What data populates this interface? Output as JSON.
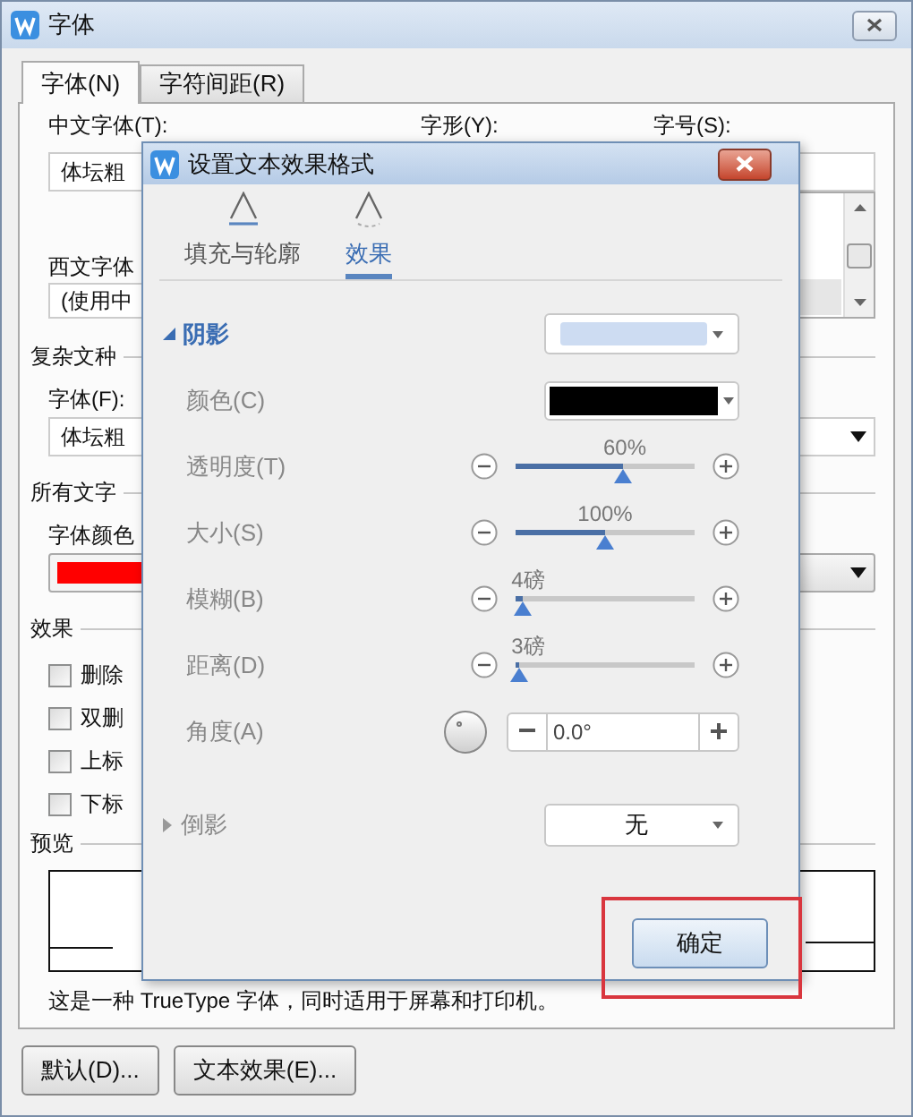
{
  "font_window": {
    "title": "字体",
    "tabs": [
      {
        "label": "字体(N)",
        "selected": true
      },
      {
        "label": "字符间距(R)",
        "selected": false
      }
    ],
    "chinese_font": {
      "label": "中文字体(T):",
      "value": "体坛粗"
    },
    "style_label": "字形(Y):",
    "size_label": "字号(S):",
    "western_font": {
      "label": "西文字体",
      "value": "(使用中"
    },
    "complex_script": {
      "heading": "复杂文种",
      "label": "字体(F):",
      "value": "体坛粗"
    },
    "all_text": {
      "heading": "所有文字",
      "color_label": "字体颜色",
      "color": "#ff0000"
    },
    "effects": {
      "heading": "效果",
      "options": [
        {
          "label": "删除",
          "checked": false
        },
        {
          "label": "双删",
          "checked": false
        },
        {
          "label": "上标",
          "checked": false
        },
        {
          "label": "下标",
          "checked": false
        }
      ]
    },
    "preview": {
      "heading": "预览"
    },
    "note": "这是一种 TrueType 字体，同时适用于屏幕和打印机。",
    "buttons": [
      "默认(D)...",
      "文本效果(E)..."
    ]
  },
  "effects_dialog": {
    "title": "设置文本效果格式",
    "tabs": [
      {
        "label": "填充与轮廓",
        "selected": false
      },
      {
        "label": "效果",
        "selected": true
      }
    ],
    "shadow": {
      "label": "阴影",
      "expanded": true,
      "rows": [
        {
          "kind": "color",
          "label": "颜色(C)",
          "color": "#000000"
        },
        {
          "kind": "slider",
          "label": "透明度(T)",
          "level": 0.6,
          "reading": "60%"
        },
        {
          "kind": "slider",
          "label": "大小(S)",
          "level": 0.5,
          "reading": "100%"
        },
        {
          "kind": "slider",
          "label": "模糊(B)",
          "level": 0.04,
          "reading": "4磅"
        },
        {
          "kind": "slider",
          "label": "距离(D)",
          "level": 0.02,
          "reading": "3磅"
        },
        {
          "kind": "angle",
          "label": "角度(A)",
          "value": "0.0°"
        }
      ]
    },
    "reflection": {
      "label": "倒影",
      "expanded": false,
      "value": "无"
    },
    "ok_button": "确定"
  }
}
